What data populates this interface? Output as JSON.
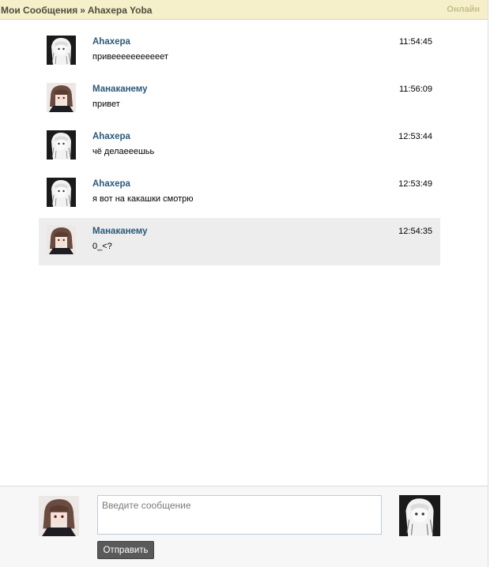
{
  "header": {
    "breadcrumb_root": "Мои Сообщения",
    "breadcrumb_sep": "»",
    "breadcrumb_peer": "Ahaxepa Yoba",
    "status": "Онлайн"
  },
  "messages": [
    {
      "author": "Ahaxepa",
      "text": "привееееееееееет",
      "time": "11:54:45",
      "avatar": "white-haired-girl-avatar"
    },
    {
      "author": "Манаканему",
      "text": "привет",
      "time": "11:56:09",
      "avatar": "dark-haired-girl-avatar"
    },
    {
      "author": "Ahaxepa",
      "text": "чё делаееешьь",
      "time": "12:53:44",
      "avatar": "white-haired-girl-avatar"
    },
    {
      "author": "Ahaxepa",
      "text": "я вот на какашки смотрю",
      "time": "12:53:49",
      "avatar": "white-haired-girl-avatar"
    },
    {
      "author": "Манаканему",
      "text": "0_<?",
      "time": "12:54:35",
      "avatar": "dark-haired-girl-avatar",
      "highlighted": true
    }
  ],
  "composer": {
    "placeholder": "Введите сообщение",
    "value": "",
    "send_label": "Отправить"
  },
  "colors": {
    "header_bg": "#f5efca",
    "author": "#2b587a",
    "highlight": "#ededed",
    "send_button": "#5a5a5a"
  }
}
